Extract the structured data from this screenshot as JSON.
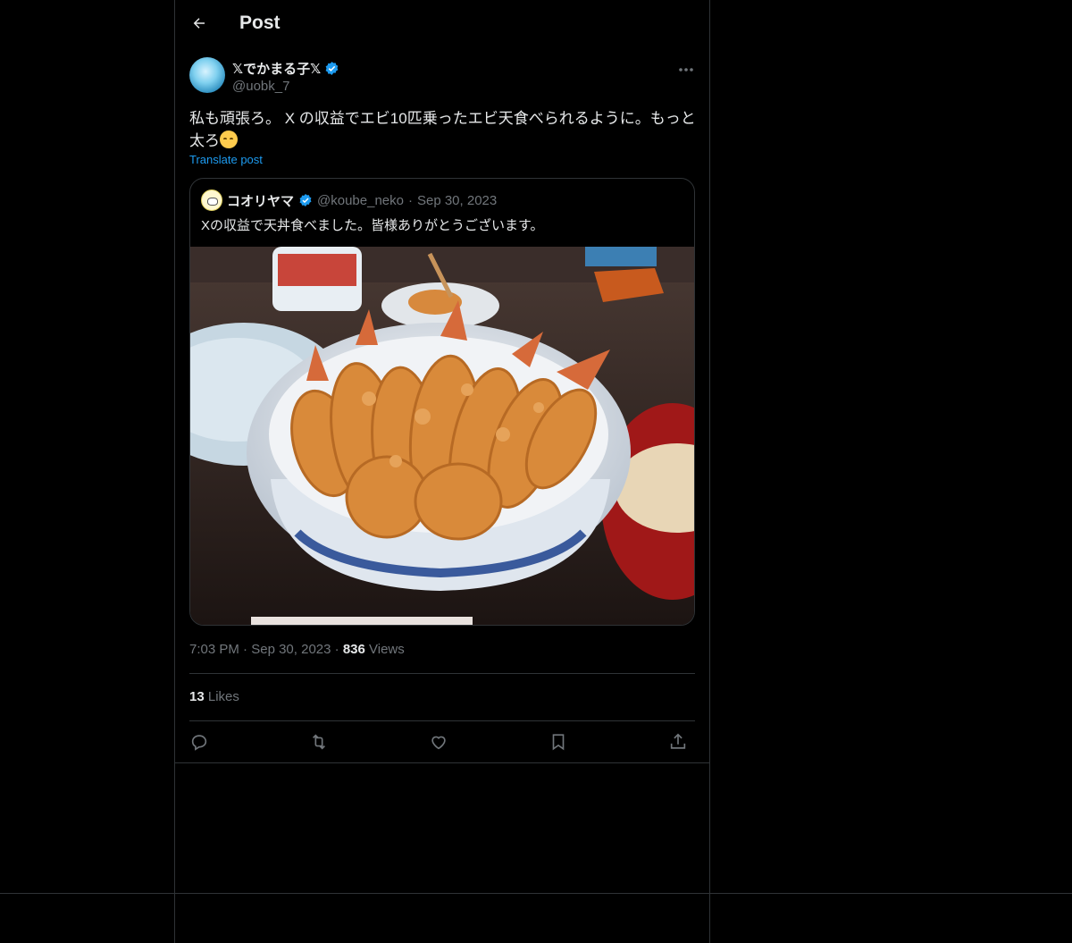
{
  "header": {
    "title": "Post"
  },
  "post": {
    "author": {
      "display_name": "𝕏でかまる子𝕏",
      "handle": "@uobk_7"
    },
    "text_line1": "私も頑張ろ。 X の収益でエビ10匹乗ったエビ天食べられるように。もっと",
    "text_line2": "太ろ",
    "translate_label": "Translate post"
  },
  "quote": {
    "display_name": "コオリヤマ",
    "handle": "@koube_neko",
    "separator": "·",
    "date": "Sep 30, 2023",
    "text": "Xの収益で天丼食べました。皆様ありがとうございます。"
  },
  "meta": {
    "time": "7:03 PM",
    "separator": "·",
    "date": "Sep 30, 2023",
    "views_count": "836",
    "views_label": "Views"
  },
  "likes": {
    "count": "13",
    "label": "Likes"
  },
  "actions": [
    "reply-icon",
    "repost-icon",
    "like-icon",
    "bookmark-icon",
    "share-icon"
  ],
  "colors": {
    "background": "#000000",
    "text": "#e7e9ea",
    "muted": "#71767b",
    "accent": "#1d9bf0",
    "border": "#2f3336"
  }
}
